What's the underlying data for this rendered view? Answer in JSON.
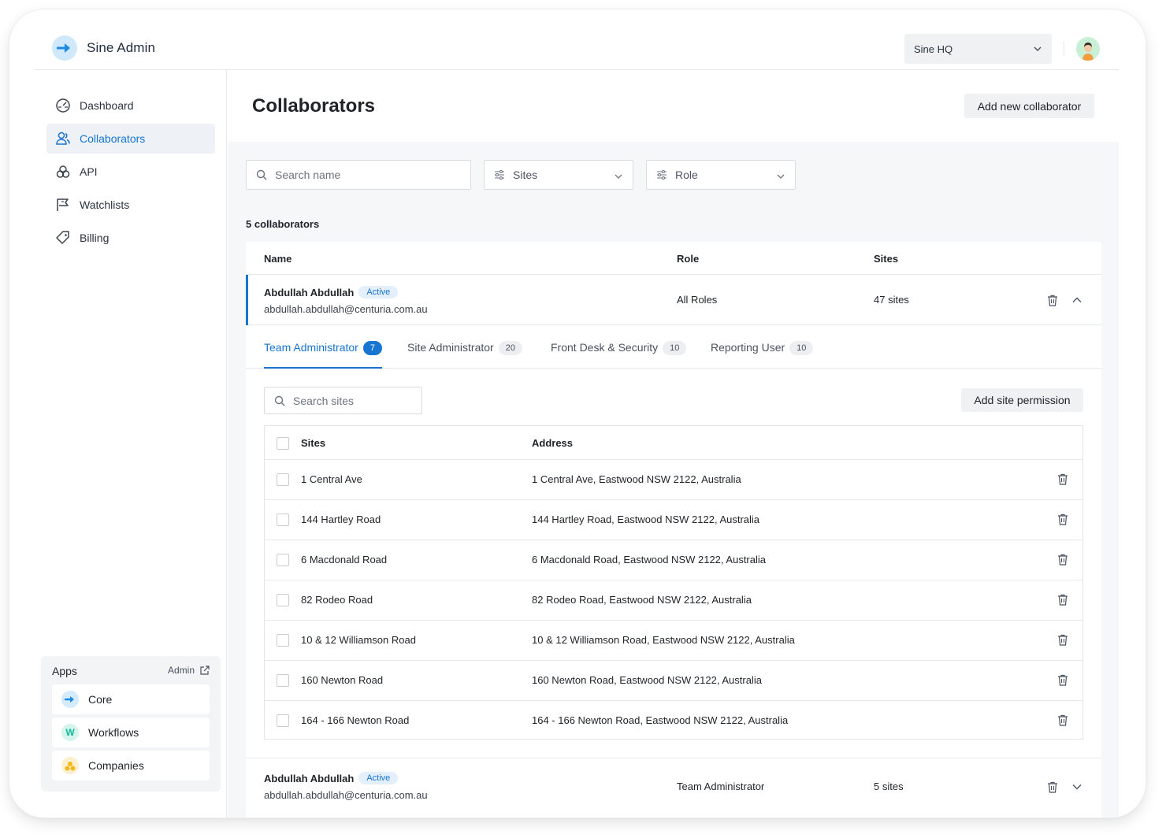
{
  "app": {
    "name": "Sine Admin"
  },
  "header": {
    "site_select": "Sine HQ"
  },
  "sidebar": {
    "items": [
      {
        "label": "Dashboard",
        "icon": "dashboard-icon"
      },
      {
        "label": "Collaborators",
        "icon": "users-icon",
        "active": true
      },
      {
        "label": "API",
        "icon": "api-icon"
      },
      {
        "label": "Watchlists",
        "icon": "flag-icon"
      },
      {
        "label": "Billing",
        "icon": "tag-icon"
      }
    ],
    "apps": {
      "title": "Apps",
      "admin_link": "Admin",
      "items": [
        {
          "label": "Core",
          "color": "#2196f3"
        },
        {
          "label": "Workflows",
          "color": "#1fbf9f",
          "glyph": "W"
        },
        {
          "label": "Companies",
          "color": "#f5b81c"
        }
      ]
    }
  },
  "page": {
    "title": "Collaborators",
    "add_button": "Add new collaborator",
    "search_placeholder": "Search name",
    "filter_sites": "Sites",
    "filter_role": "Role",
    "count_label": "5 collaborators",
    "columns": {
      "name": "Name",
      "role": "Role",
      "sites": "Sites"
    }
  },
  "collaborators": [
    {
      "name": "Abdullah Abdullah",
      "status": "Active",
      "email": "abdullah.abdullah@centuria.com.au",
      "role": "All Roles",
      "sites": "47 sites",
      "expanded": true
    },
    {
      "name": "Abdullah Abdullah",
      "status": "Active",
      "email": "abdullah.abdullah@centuria.com.au",
      "role": "Team Administrator",
      "sites": "5 sites",
      "expanded": false
    }
  ],
  "expanded": {
    "tabs": [
      {
        "label": "Team Administrator",
        "count": "7",
        "active": true
      },
      {
        "label": "Site Administrator",
        "count": "20"
      },
      {
        "label": "Front Desk & Security",
        "count": "10"
      },
      {
        "label": "Reporting User",
        "count": "10"
      }
    ],
    "search_placeholder": "Search sites",
    "add_button": "Add site permission",
    "columns": {
      "sites": "Sites",
      "address": "Address"
    },
    "rows": [
      {
        "site": "1 Central Ave",
        "address": "1 Central Ave, Eastwood NSW 2122, Australia"
      },
      {
        "site": "144 Hartley Road",
        "address": "144 Hartley Road, Eastwood NSW 2122, Australia"
      },
      {
        "site": "6 Macdonald Road",
        "address": "6 Macdonald Road, Eastwood NSW 2122, Australia"
      },
      {
        "site": "82 Rodeo Road",
        "address": "82 Rodeo Road, Eastwood NSW 2122, Australia"
      },
      {
        "site": "10 & 12 Williamson Road",
        "address": "10 & 12 Williamson Road, Eastwood NSW 2122, Australia"
      },
      {
        "site": "160 Newton Road",
        "address": "160 Newton Road, Eastwood NSW 2122, Australia"
      },
      {
        "site": "164 - 166 Newton Road",
        "address": "164 - 166 Newton Road, Eastwood NSW 2122, Australia"
      }
    ]
  },
  "colors": {
    "accent": "#1774d1",
    "badge_bg": "#e3f0fc"
  }
}
